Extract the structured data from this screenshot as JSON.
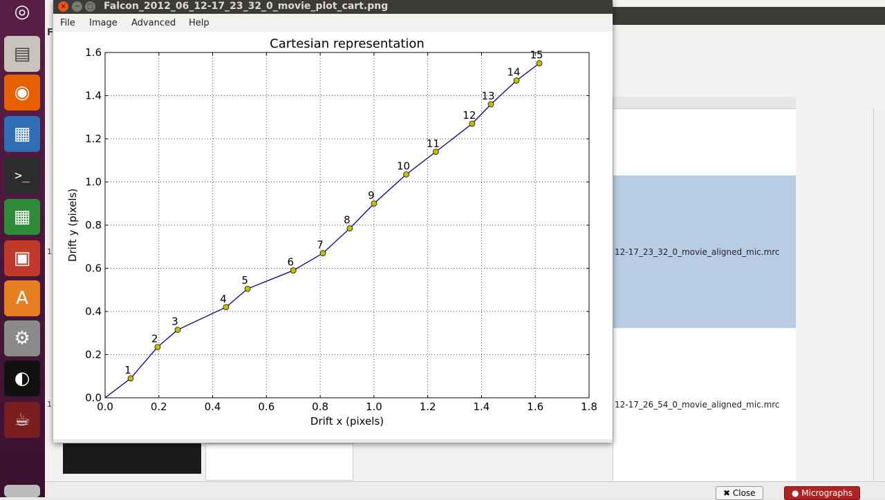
{
  "window": {
    "title": "Falcon_2012_06_12-17_23_32_0_movie_plot_cart.png",
    "menu": [
      "File",
      "Image",
      "Advanced",
      "Help"
    ]
  },
  "background_app": {
    "left_labels": [
      "F",
      "1",
      "1"
    ],
    "rows": [
      "12-17_23_32_0_movie_aligned_mic.mrc",
      "12-17_26_54_0_movie_aligned_mic.mrc"
    ],
    "buttons": {
      "close": "Close",
      "micrographs": "Micrographs"
    }
  },
  "colors": {
    "line": "#00008b",
    "marker": "#bfbf00",
    "selected_row": "#b8cce4",
    "launcher": "#4a1a3c"
  },
  "chart_data": {
    "type": "line",
    "title": "Cartesian representation",
    "xlabel": "Drift x (pixels)",
    "ylabel": "Drift y (pixels)",
    "xlim": [
      0.0,
      1.8
    ],
    "ylim": [
      0.0,
      1.6
    ],
    "xticks": [
      "0.0",
      "0.2",
      "0.4",
      "0.6",
      "0.8",
      "1.0",
      "1.2",
      "1.4",
      "1.6",
      "1.8"
    ],
    "yticks": [
      "0.0",
      "0.2",
      "0.4",
      "0.6",
      "0.8",
      "1.0",
      "1.2",
      "1.4",
      "1.6"
    ],
    "grid": true,
    "origin": [
      0.0,
      0.0
    ],
    "points": [
      {
        "label": "1",
        "x": 0.095,
        "y": 0.09
      },
      {
        "label": "2",
        "x": 0.195,
        "y": 0.235
      },
      {
        "label": "3",
        "x": 0.27,
        "y": 0.315
      },
      {
        "label": "4",
        "x": 0.45,
        "y": 0.42
      },
      {
        "label": "5",
        "x": 0.53,
        "y": 0.505
      },
      {
        "label": "6",
        "x": 0.7,
        "y": 0.59
      },
      {
        "label": "7",
        "x": 0.81,
        "y": 0.67
      },
      {
        "label": "8",
        "x": 0.91,
        "y": 0.785
      },
      {
        "label": "9",
        "x": 1.0,
        "y": 0.9
      },
      {
        "label": "10",
        "x": 1.12,
        "y": 1.035
      },
      {
        "label": "11",
        "x": 1.23,
        "y": 1.14
      },
      {
        "label": "12",
        "x": 1.365,
        "y": 1.27
      },
      {
        "label": "13",
        "x": 1.435,
        "y": 1.36
      },
      {
        "label": "14",
        "x": 1.53,
        "y": 1.47
      },
      {
        "label": "15",
        "x": 1.615,
        "y": 1.55
      }
    ]
  }
}
